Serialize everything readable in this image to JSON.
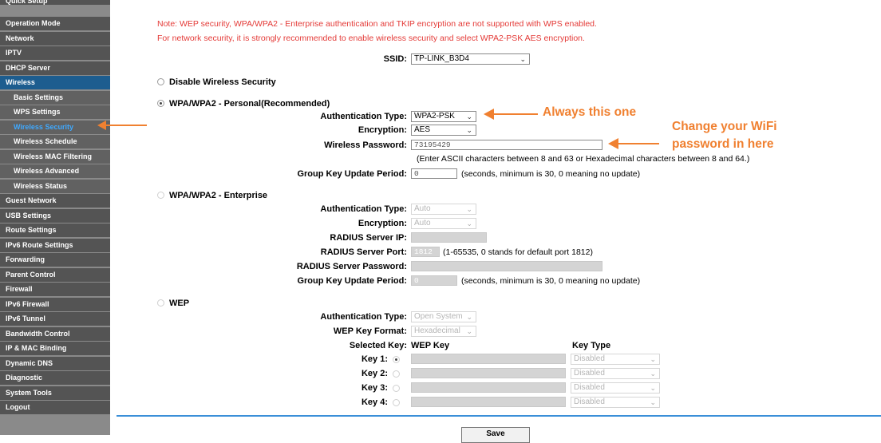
{
  "sidebar": {
    "cut_item": "Quick Setup",
    "items": [
      {
        "label": "Operation Mode",
        "type": "main"
      },
      {
        "label": "Network",
        "type": "main"
      },
      {
        "label": "IPTV",
        "type": "main"
      },
      {
        "label": "DHCP Server",
        "type": "main"
      },
      {
        "label": "Wireless",
        "type": "active"
      },
      {
        "label": "Basic Settings",
        "type": "sub"
      },
      {
        "label": "WPS Settings",
        "type": "sub"
      },
      {
        "label": "Wireless Security",
        "type": "current"
      },
      {
        "label": "Wireless Schedule",
        "type": "sub"
      },
      {
        "label": "Wireless MAC Filtering",
        "type": "sub"
      },
      {
        "label": "Wireless Advanced",
        "type": "sub"
      },
      {
        "label": "Wireless Status",
        "type": "sub"
      },
      {
        "label": "Guest Network",
        "type": "main"
      },
      {
        "label": "USB Settings",
        "type": "main"
      },
      {
        "label": "Route Settings",
        "type": "main"
      },
      {
        "label": "IPv6 Route Settings",
        "type": "main"
      },
      {
        "label": "Forwarding",
        "type": "main"
      },
      {
        "label": "Parent Control",
        "type": "main"
      },
      {
        "label": "Firewall",
        "type": "main"
      },
      {
        "label": "IPv6 Firewall",
        "type": "main"
      },
      {
        "label": "IPv6 Tunnel",
        "type": "main"
      },
      {
        "label": "Bandwidth Control",
        "type": "main"
      },
      {
        "label": "IP & MAC Binding",
        "type": "main"
      },
      {
        "label": "Dynamic DNS",
        "type": "main"
      },
      {
        "label": "Diagnostic",
        "type": "main"
      },
      {
        "label": "System Tools",
        "type": "main"
      },
      {
        "label": "Logout",
        "type": "main"
      }
    ]
  },
  "notes": [
    "Note: WEP security, WPA/WPA2 - Enterprise authentication and TKIP encryption are not supported with WPS enabled.",
    "For network security, it is strongly recommended to enable wireless security and select WPA2-PSK AES encryption."
  ],
  "ssid": {
    "label": "SSID:",
    "value": "TP-LINK_B3D4"
  },
  "disable": {
    "label": "Disable Wireless Security"
  },
  "personal": {
    "title": "WPA/WPA2 - Personal(Recommended)",
    "auth_label": "Authentication Type:",
    "auth_value": "WPA2-PSK",
    "enc_label": "Encryption:",
    "enc_value": "AES",
    "pwd_label": "Wireless Password:",
    "pwd_value": "73195429",
    "pwd_hint": "(Enter ASCII characters between 8 and 63 or Hexadecimal characters between 8 and 64.)",
    "gk_label": "Group Key Update Period:",
    "gk_value": "0",
    "gk_hint": "(seconds, minimum is 30, 0 meaning no update)"
  },
  "enterprise": {
    "title": "WPA/WPA2 - Enterprise",
    "auth_label": "Authentication Type:",
    "auth_value": "Auto",
    "enc_label": "Encryption:",
    "enc_value": "Auto",
    "ip_label": "RADIUS Server IP:",
    "port_label": "RADIUS Server Port:",
    "port_value": "1812",
    "port_hint": "(1-65535, 0 stands for default port 1812)",
    "pwd_label": "RADIUS Server Password:",
    "gk_label": "Group Key Update Period:",
    "gk_value": "0",
    "gk_hint": "(seconds, minimum is 30, 0 meaning no update)"
  },
  "wep": {
    "title": "WEP",
    "auth_label": "Authentication Type:",
    "auth_value": "Open System",
    "fmt_label": "WEP Key Format:",
    "fmt_value": "Hexadecimal",
    "sel_label": "Selected Key:",
    "key_col": "WEP Key",
    "type_col": "Key Type",
    "keys": [
      {
        "label": "Key 1:",
        "type": "Disabled"
      },
      {
        "label": "Key 2:",
        "type": "Disabled"
      },
      {
        "label": "Key 3:",
        "type": "Disabled"
      },
      {
        "label": "Key 4:",
        "type": "Disabled"
      }
    ]
  },
  "annotations": {
    "always": "Always this one",
    "change_1": "Change your WiFi",
    "change_2": "password in here",
    "color": "#f08030"
  },
  "save_label": "Save",
  "colors": {
    "note": "#e43a37",
    "sidebar": "#545454",
    "active": "#1d5d8f",
    "divider": "#3b8fd8"
  }
}
